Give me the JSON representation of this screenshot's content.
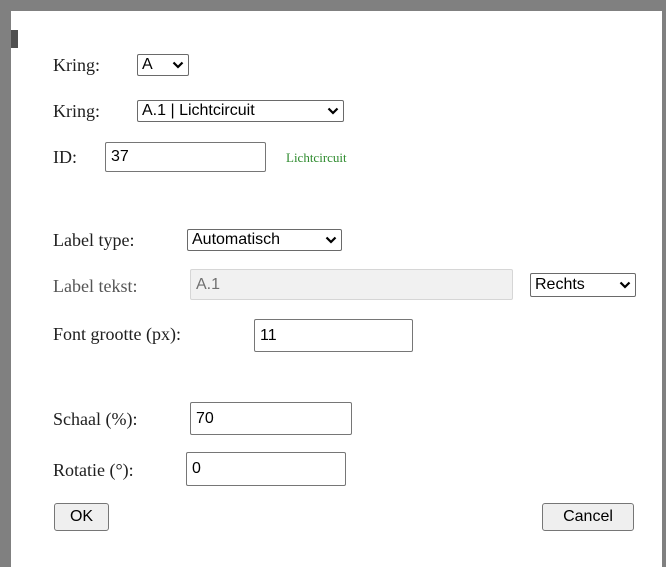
{
  "dialog": {
    "kring_group": {
      "label": "Kring:",
      "selected": "A"
    },
    "kring_circuit": {
      "label": "Kring:",
      "selected": "A.1 | Lichtcircuit"
    },
    "id_field": {
      "label": "ID:",
      "value": "37",
      "hint": "Lichtcircuit",
      "hint_color": "#2e8b2e"
    },
    "label_type": {
      "label": "Label type:",
      "selected": "Automatisch"
    },
    "label_text": {
      "label": "Label tekst:",
      "value": "A.1",
      "position_selected": "Rechts"
    },
    "font_size": {
      "label": "Font grootte (px):",
      "value": "11"
    },
    "scale": {
      "label": "Schaal (%):",
      "value": "70"
    },
    "rotation": {
      "label": "Rotatie (°):",
      "value": "0"
    },
    "buttons": {
      "ok": "OK",
      "cancel": "Cancel"
    }
  }
}
